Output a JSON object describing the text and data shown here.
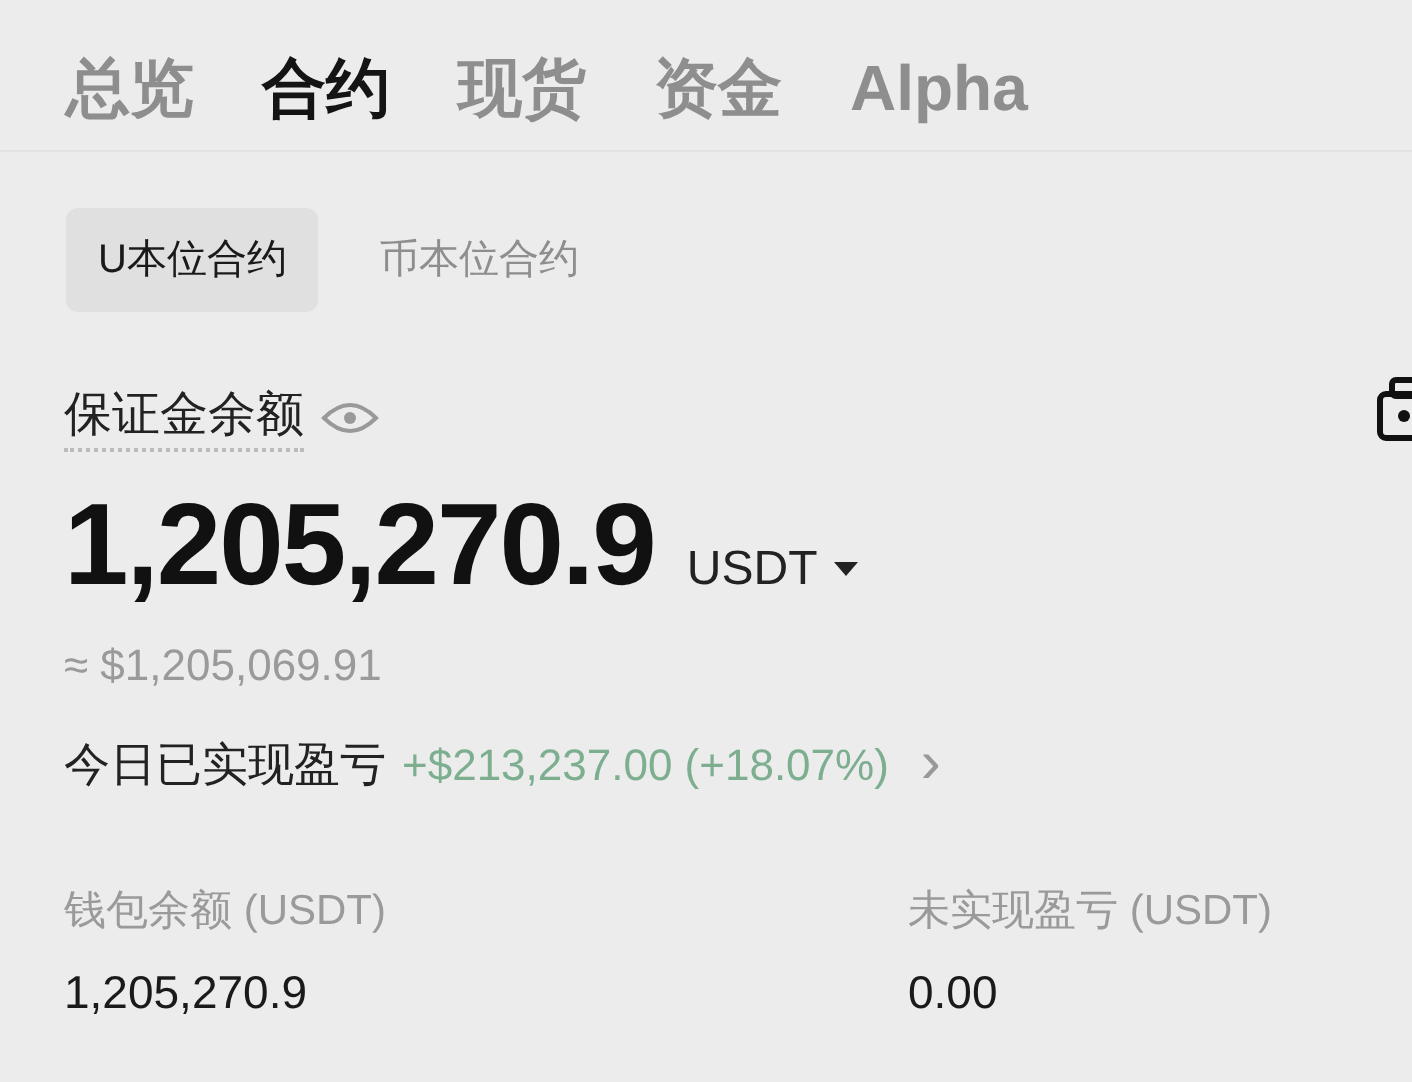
{
  "tabs": [
    {
      "label": "总览",
      "selected": false
    },
    {
      "label": "合约",
      "selected": true
    },
    {
      "label": "现货",
      "selected": false
    },
    {
      "label": "资金",
      "selected": false
    },
    {
      "label": "Alpha",
      "selected": false
    }
  ],
  "subtabs": [
    {
      "label": "U本位合约",
      "selected": true
    },
    {
      "label": "币本位合约",
      "selected": false
    }
  ],
  "balance": {
    "label": "保证金余额",
    "amount": "1,205,270.9",
    "unit": "USDT",
    "approx": "≈ $1,205,069.91"
  },
  "pnl": {
    "label": "今日已实现盈亏",
    "value": "+$213,237.00 (+18.07%)",
    "arrow": "›"
  },
  "stats": [
    {
      "label": "钱包余额 (USDT)",
      "value": "1,205,270.9"
    },
    {
      "label": "未实现盈亏 (USDT)",
      "value": "0.00"
    }
  ]
}
